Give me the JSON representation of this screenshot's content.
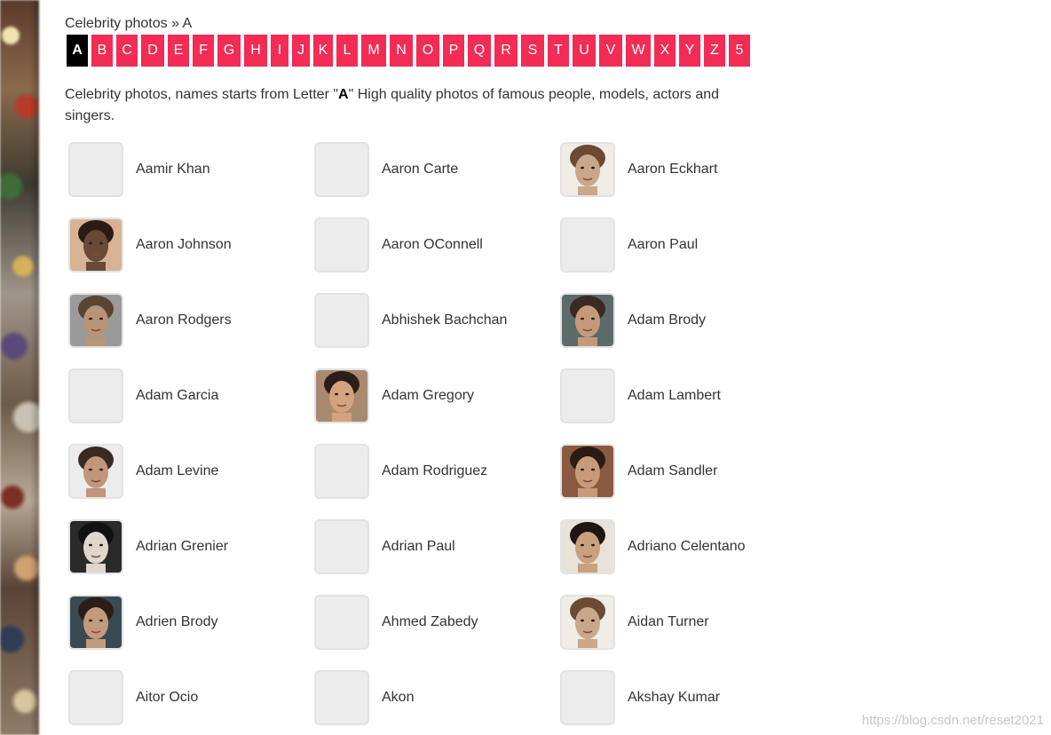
{
  "breadcrumb": {
    "root": "Celebrity photos",
    "separator": "»",
    "current": "A"
  },
  "letters": [
    "A",
    "B",
    "C",
    "D",
    "E",
    "F",
    "G",
    "H",
    "I",
    "J",
    "K",
    "L",
    "M",
    "N",
    "O",
    "P",
    "Q",
    "R",
    "S",
    "T",
    "U",
    "V",
    "W",
    "X",
    "Y",
    "Z",
    "5"
  ],
  "active_letter": "A",
  "intro": {
    "before": "Celebrity photos, names starts from Letter \"",
    "letter": "A",
    "after": "\" High quality photos of famous people, models, actors and singers."
  },
  "people": [
    {
      "name": "Aamir Khan",
      "has_photo": false
    },
    {
      "name": "Aaron Carte",
      "has_photo": false
    },
    {
      "name": "Aaron Eckhart",
      "has_photo": true
    },
    {
      "name": "Aaron Johnson",
      "has_photo": true
    },
    {
      "name": "Aaron OConnell",
      "has_photo": false
    },
    {
      "name": "Aaron Paul",
      "has_photo": false
    },
    {
      "name": "Aaron Rodgers",
      "has_photo": true
    },
    {
      "name": "Abhishek Bachchan",
      "has_photo": false
    },
    {
      "name": "Adam Brody",
      "has_photo": true
    },
    {
      "name": "Adam Garcia",
      "has_photo": false
    },
    {
      "name": "Adam Gregory",
      "has_photo": true
    },
    {
      "name": "Adam Lambert",
      "has_photo": false
    },
    {
      "name": "Adam Levine",
      "has_photo": true
    },
    {
      "name": "Adam Rodriguez",
      "has_photo": false
    },
    {
      "name": "Adam Sandler",
      "has_photo": true
    },
    {
      "name": "Adrian Grenier",
      "has_photo": true
    },
    {
      "name": "Adrian Paul",
      "has_photo": false
    },
    {
      "name": "Adriano Celentano",
      "has_photo": true
    },
    {
      "name": "Adrien Brody",
      "has_photo": true
    },
    {
      "name": "Ahmed Zabedy",
      "has_photo": false
    },
    {
      "name": "Aidan Turner",
      "has_photo": true
    },
    {
      "name": "Aitor Ocio",
      "has_photo": false
    },
    {
      "name": "Akon",
      "has_photo": false
    },
    {
      "name": "Akshay Kumar",
      "has_photo": false
    }
  ],
  "watermark": "https://blog.csdn.net/reset2021",
  "colors": {
    "letter_bg": "#f22c54",
    "letter_active_bg": "#000000",
    "placeholder_bg": "#ececec"
  }
}
